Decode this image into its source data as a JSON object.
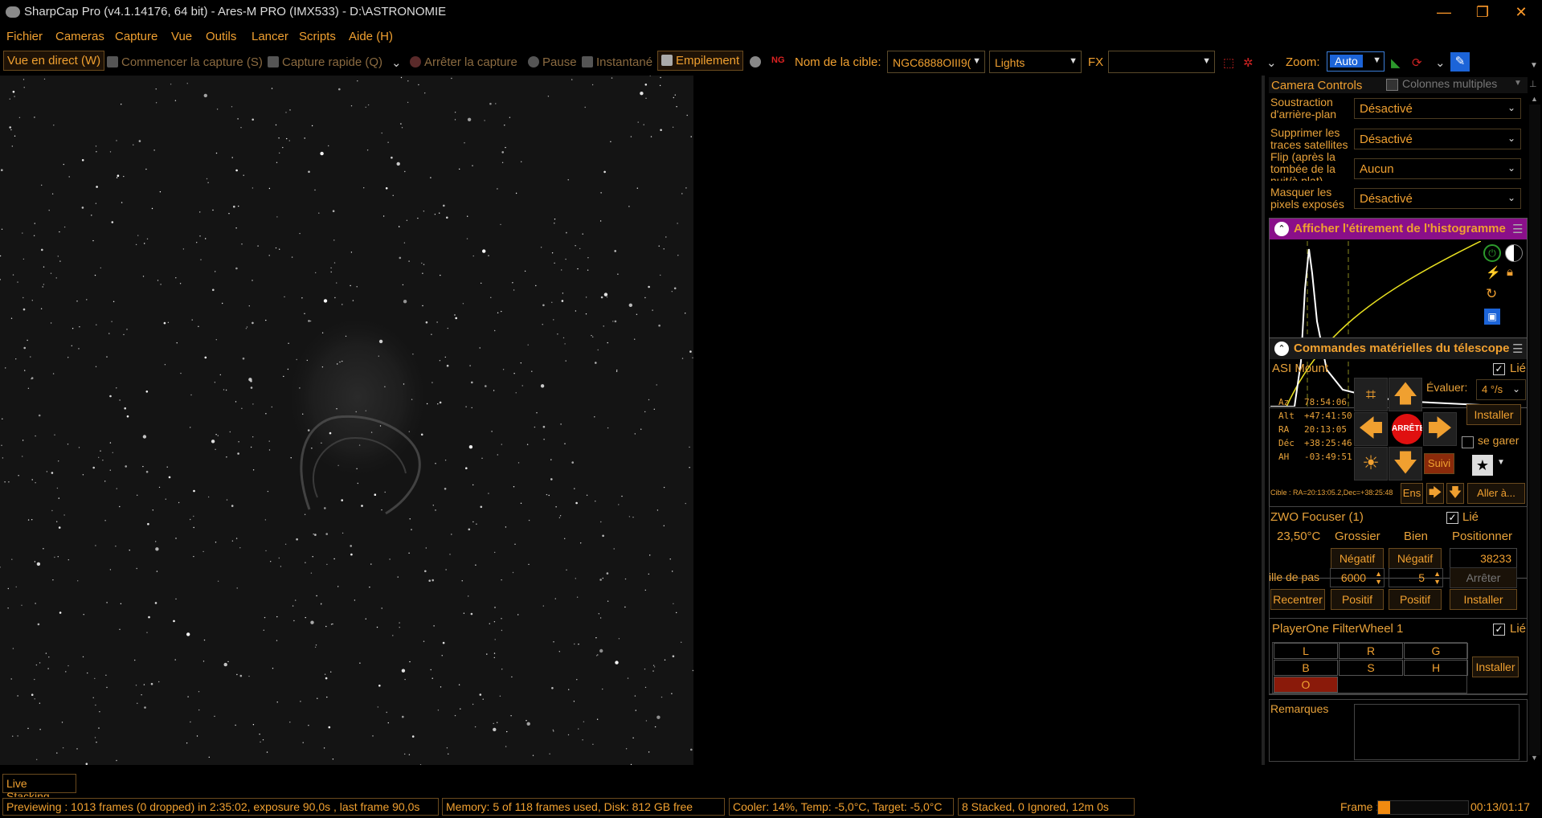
{
  "window": {
    "title": "SharpCap Pro (v4.1.14176, 64 bit) - Ares-M PRO (IMX533) - D:\\ASTRONOMIE",
    "minimize": "—",
    "restore": "❐",
    "close": "✕"
  },
  "menu": [
    "Fichier",
    "Cameras",
    "Capture",
    "Vue",
    "Outils",
    "Lancer",
    "Scripts",
    "Aide (H)"
  ],
  "toolbar": {
    "live_view": "Vue en direct (W)",
    "start_capture": "Commencer la capture (S)",
    "quick_capture": "Capture rapide (Q)",
    "stop_capture": "Arrêter la capture",
    "pause": "Pause",
    "snapshot": "Instantané",
    "stacking": "Empilement",
    "target_label": "Nom de la cible:",
    "target_value": "NGC6888OIII9(",
    "frame_type": "Lights",
    "fx_label": "FX",
    "fx_value": "",
    "zoom_label": "Zoom:",
    "zoom_value": "Auto"
  },
  "camera_controls": {
    "title": "Camera Controls",
    "multi_columns": "Colonnes multiples",
    "rows": [
      {
        "label": "Soustraction d'arrière-plan",
        "value": "Désactivé"
      },
      {
        "label": "Supprimer les traces satellites",
        "value": "Désactivé"
      },
      {
        "label": "Flip (après la tombée de la nuit/à plat)",
        "value": "Aucun"
      },
      {
        "label": "Masquer les pixels exposés",
        "value": "Désactivé"
      }
    ]
  },
  "histogram": {
    "title": "Afficher l'étirement de l'histogramme"
  },
  "telescope": {
    "title": "Commandes matérielles du télescope",
    "mount_name": "ASI Mount",
    "linked": "Lié",
    "coords": [
      {
        "k": "Az",
        "v": "78:54:06"
      },
      {
        "k": "Alt",
        "v": "+47:41:50"
      },
      {
        "k": "RA",
        "v": "20:13:05"
      },
      {
        "k": "Déc",
        "v": "+38:25:46"
      },
      {
        "k": "AH",
        "v": "-03:49:51"
      }
    ],
    "stop": "ARRÊTE",
    "rate_label": "Évaluer:",
    "rate_value": "4 °/s",
    "setup": "Installer",
    "park": "se garer",
    "track": "Suivi",
    "target": "Cible : RA=20:13:05.2,Dec=+38:25:48",
    "sync": "Ens",
    "goto": "Aller à..."
  },
  "focuser": {
    "name": "ZWO Focuser (1)",
    "linked": "Lié",
    "temp": "23,50°C",
    "col_coarse": "Grossier",
    "col_fine": "Bien",
    "col_position": "Positionner",
    "neg": "Négatif",
    "position_value": "38233",
    "step_label": "ille de pas",
    "coarse_step": "6000",
    "fine_step": "5",
    "stop": "Arrêter",
    "recenter": "Recentrer",
    "pos": "Positif",
    "setup": "Installer"
  },
  "filterwheel": {
    "name": "PlayerOne FilterWheel 1",
    "linked": "Lié",
    "filters": [
      "L",
      "R",
      "G",
      "B",
      "S",
      "H",
      "O"
    ],
    "selected": "O",
    "setup": "Installer"
  },
  "notes": {
    "label": "Remarques"
  },
  "live_stacking": "Live Stacking",
  "status": {
    "preview": "Previewing : 1013 frames (0 dropped) in 2:35:02, exposure 90,0s , last frame 90,0s",
    "memory": "Memory: 5 of 118 frames used, Disk: 812 GB free",
    "cooler": "Cooler: 14%, Temp: -5,0°C, Target: -5,0°C",
    "stack": "8 Stacked, 0 Ignored, 12m 0s",
    "frame_label": "Frame :",
    "frame_progress": 0.13,
    "frame_time": "00:13/01:17"
  }
}
